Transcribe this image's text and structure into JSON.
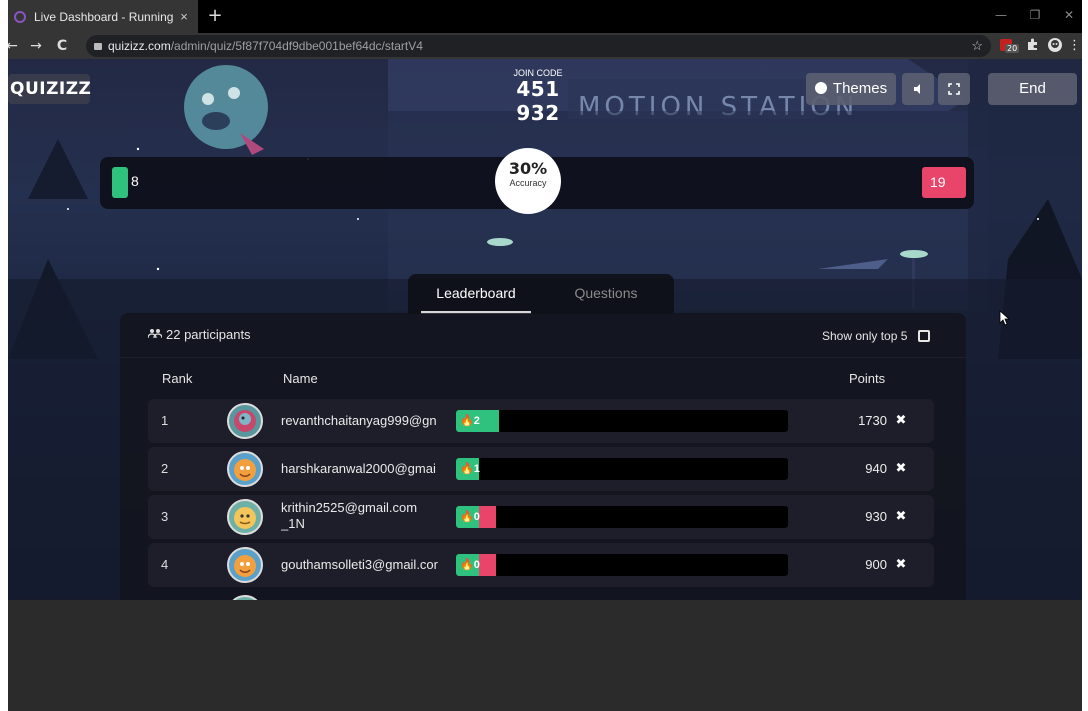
{
  "browser": {
    "tab_title": "Live Dashboard - Running",
    "tab_close": "×",
    "new_tab": "+",
    "back": "←",
    "forward": "→",
    "reload": "C",
    "url_host": "quizizz.com",
    "url_path": "/admin/quiz/5f87f704df9dbe001bef64dc/startV4",
    "bookmark_star": "☆",
    "extension_badge": "20",
    "minimize": "—",
    "restore": "❐",
    "close": "✕"
  },
  "app": {
    "logo": "QUIZIZZ",
    "join_code_label": "JOIN CODE",
    "join_code": "451 932",
    "background_sign": "MOTION STATION",
    "themes_label": "Themes",
    "end_label": "End"
  },
  "accuracy": {
    "correct_count": "8",
    "incorrect_count": "19",
    "percent": "30%",
    "label": "Accuracy",
    "correct_color": "#2ec27e",
    "incorrect_color": "#e9446a"
  },
  "tabs": {
    "leaderboard": "Leaderboard",
    "questions": "Questions"
  },
  "leaderboard": {
    "participants": "22 participants",
    "show_top5": "Show only top 5",
    "col_rank": "Rank",
    "col_name": "Name",
    "col_points": "Points",
    "remove_icon": "✖",
    "rows": [
      {
        "rank": "1",
        "name": "revanthchaitanyag999@gn",
        "streak": "2",
        "points": "1730",
        "green_fraction": 0.13,
        "red_fraction": 0
      },
      {
        "rank": "2",
        "name": "harshkaranwal2000@gmai",
        "streak": "1",
        "points": "940",
        "green_fraction": 0.07,
        "red_fraction": 0
      },
      {
        "rank": "3",
        "name": "krithin2525@gmail.com\n_1N",
        "streak": "0",
        "points": "930",
        "green_fraction": 0.07,
        "red_fraction": 0.05
      },
      {
        "rank": "4",
        "name": "gouthamsolleti3@gmail.cor",
        "streak": "0",
        "points": "900",
        "green_fraction": 0.07,
        "red_fraction": 0.05
      }
    ]
  }
}
